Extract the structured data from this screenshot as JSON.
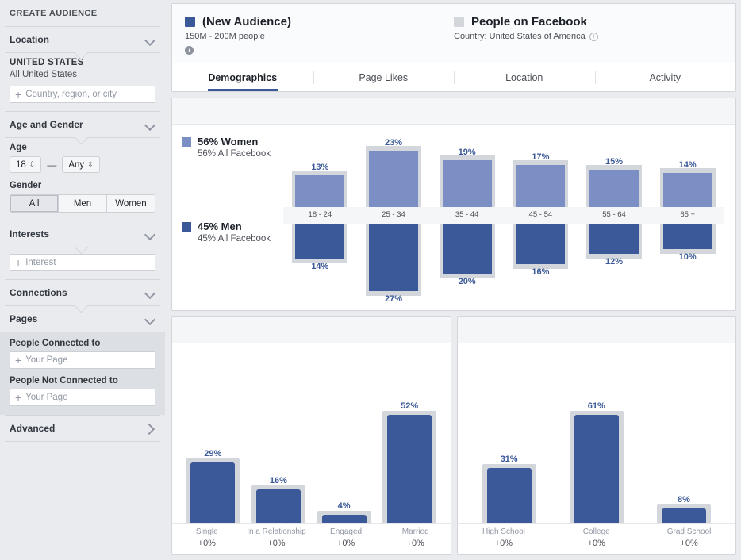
{
  "sidebar": {
    "title": "CREATE AUDIENCE",
    "sections": {
      "location": {
        "label": "Location",
        "country": "UNITED STATES",
        "scope": "All United States",
        "input_placeholder": "Country, region, or city",
        "chevron": "chevron-down-icon"
      },
      "age_gender": {
        "label": "Age and Gender",
        "age_label": "Age",
        "age_min": "18",
        "age_max": "Any",
        "dash": "—",
        "gender_label": "Gender",
        "gender_options": [
          "All",
          "Men",
          "Women"
        ],
        "gender_selected": "All"
      },
      "interests": {
        "label": "Interests",
        "input_placeholder": "Interest"
      },
      "connections": {
        "label": "Connections"
      },
      "pages": {
        "label": "Pages",
        "connected_label": "People Connected to",
        "connected_placeholder": "Your Page",
        "not_connected_label": "People Not Connected to",
        "not_connected_placeholder": "Your Page"
      },
      "advanced": {
        "label": "Advanced",
        "chevron": "chevron-right-icon"
      }
    }
  },
  "header": {
    "audience": {
      "name": "(New Audience)",
      "size": "150M - 200M people",
      "color": "#3b5998",
      "info_icon": "info-icon"
    },
    "benchmark": {
      "name": "People on Facebook",
      "detail": "Country: United States of America",
      "color": "#d3d6db",
      "info_icon": "info-icon"
    },
    "tabs": [
      {
        "label": "Demographics",
        "active": true
      },
      {
        "label": "Page Likes",
        "active": false
      },
      {
        "label": "Location",
        "active": false
      },
      {
        "label": "Activity",
        "active": false
      }
    ]
  },
  "chart_data": [
    {
      "type": "bar",
      "name": "age-and-gender",
      "title": "",
      "orientation": "diverging-vertical",
      "xlabel": "",
      "ylabel": "",
      "categories": [
        "18 - 24",
        "25 - 34",
        "35 - 44",
        "45 - 54",
        "55 - 64",
        "65 +"
      ],
      "series": [
        {
          "name": "Women",
          "color": "#7b8fc4",
          "legend_title": "56% Women",
          "legend_sub": "56% All Facebook",
          "values": [
            13,
            23,
            19,
            17,
            15,
            14
          ],
          "labels": [
            "13%",
            "23%",
            "19%",
            "17%",
            "15%",
            "14%"
          ]
        },
        {
          "name": "Men",
          "color": "#3b5998",
          "legend_title": "45% Men",
          "legend_sub": "45% All Facebook",
          "values": [
            14,
            27,
            20,
            16,
            12,
            10
          ],
          "labels": [
            "14%",
            "27%",
            "20%",
            "16%",
            "12%",
            "10%"
          ]
        }
      ],
      "benchmark_color": "#d3d6db",
      "ylim": [
        0,
        29
      ]
    },
    {
      "type": "bar",
      "name": "relationship-status",
      "title": "",
      "xlabel": "",
      "ylabel": "",
      "categories": [
        "Single",
        "In a Relationship",
        "Engaged",
        "Married"
      ],
      "values": [
        29,
        16,
        4,
        52
      ],
      "labels": [
        "29%",
        "16%",
        "4%",
        "52%"
      ],
      "deltas": [
        "+0%",
        "+0%",
        "+0%",
        "+0%"
      ],
      "color": "#3b5998",
      "benchmark_color": "#d3d6db",
      "ylim": [
        0,
        58
      ]
    },
    {
      "type": "bar",
      "name": "education-level",
      "title": "",
      "xlabel": "",
      "ylabel": "",
      "categories": [
        "High School",
        "College",
        "Grad School"
      ],
      "values": [
        31,
        61,
        8
      ],
      "labels": [
        "31%",
        "61%",
        "8%"
      ],
      "deltas": [
        "+0%",
        "+0%",
        "+0%"
      ],
      "color": "#3b5998",
      "benchmark_color": "#d3d6db",
      "ylim": [
        0,
        68
      ]
    }
  ]
}
